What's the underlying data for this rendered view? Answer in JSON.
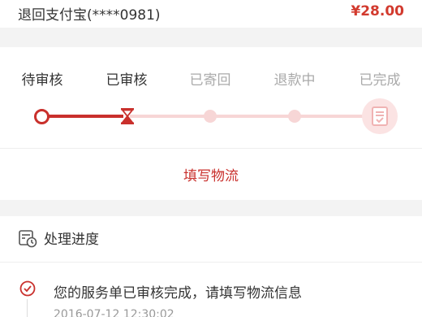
{
  "refund": {
    "method": "退回支付宝(****0981)",
    "amount": "¥28.00"
  },
  "progress": {
    "steps": [
      {
        "label": "待审核",
        "state": "done"
      },
      {
        "label": "已审核",
        "state": "current"
      },
      {
        "label": "已寄回",
        "state": "pending"
      },
      {
        "label": "退款中",
        "state": "pending"
      },
      {
        "label": "已完成",
        "state": "pending"
      }
    ],
    "action_label": "填写物流"
  },
  "history": {
    "title": "处理进度",
    "entries": [
      {
        "text": "您的服务单已审核完成，请填写物流信息",
        "time": "2016-07-12  12:30:02"
      }
    ]
  },
  "colors": {
    "accent": "#c9302c",
    "accent_light": "#f7d6d6"
  },
  "icons": [
    "hourglass-icon",
    "document-check-icon",
    "calendar-clock-icon",
    "check-circle-icon"
  ]
}
